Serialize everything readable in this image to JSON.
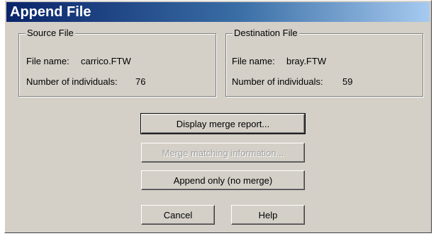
{
  "window": {
    "title": "Append File"
  },
  "source": {
    "legend": "Source File",
    "file_name_label": "File name:",
    "file_name": "carrico.FTW",
    "count_label": "Number of individuals:",
    "count": "76"
  },
  "destination": {
    "legend": "Destination File",
    "file_name_label": "File name:",
    "file_name": "bray.FTW",
    "count_label": "Number of individuals:",
    "count": "59"
  },
  "buttons": {
    "display_report": "Display merge report...",
    "merge_matching": "Merge matching information...",
    "append_only": "Append only (no merge)",
    "cancel": "Cancel",
    "help": "Help"
  }
}
